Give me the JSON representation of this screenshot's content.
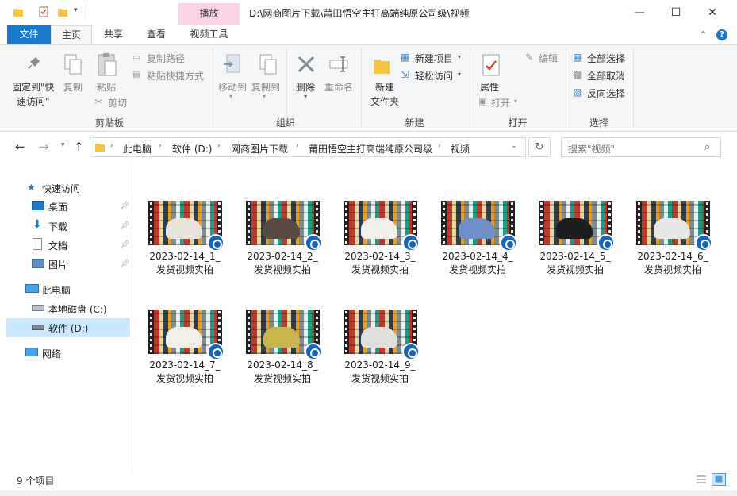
{
  "window": {
    "title": "D:\\网商图片下载\\莆田悟空主打高端纯原公司级\\视频",
    "context_tab": "播放",
    "minimize": "—",
    "maximize": "☐",
    "close": "✕"
  },
  "tabs": [
    "文件",
    "主页",
    "共享",
    "查看",
    "视频工具"
  ],
  "ribbon": {
    "clipboard": {
      "pin_quick": "固定到\"快\n速访问\"",
      "copy": "复制",
      "paste": "粘贴",
      "copy_path": "复制路径",
      "paste_shortcut": "粘贴快捷方式",
      "cut": "剪切",
      "label": "剪贴板"
    },
    "organize": {
      "move_to": "移动到",
      "copy_to": "复制到",
      "delete": "删除",
      "rename": "重命名",
      "label": "组织"
    },
    "new": {
      "new_folder": "新建\n文件夹",
      "new_item": "新建项目",
      "easy_access": "轻松访问",
      "label": "新建"
    },
    "open": {
      "properties": "属性",
      "open": "打开",
      "edit": "编辑",
      "label": "打开"
    },
    "select": {
      "select_all": "全部选择",
      "select_none": "全部取消",
      "invert": "反向选择",
      "label": "选择"
    }
  },
  "address": {
    "crumbs": [
      "此电脑",
      "软件 (D:)",
      "网商图片下载",
      "莆田悟空主打高端纯原公司级",
      "视频"
    ],
    "search_placeholder": "搜索\"视频\""
  },
  "sidebar": {
    "quick_access": "快速访问",
    "desktop": "桌面",
    "downloads": "下载",
    "documents": "文档",
    "pictures": "图片",
    "this_pc": "此电脑",
    "local_c": "本地磁盘 (C:)",
    "soft_d": "软件 (D:)",
    "network": "网络"
  },
  "files": [
    {
      "line1": "2023-02-14_1_",
      "line2": "发货视频实拍",
      "shoe": "#e8e4dc"
    },
    {
      "line1": "2023-02-14_2_",
      "line2": "发货视频实拍",
      "shoe": "#5b4a3f"
    },
    {
      "line1": "2023-02-14_3_",
      "line2": "发货视频实拍",
      "shoe": "#f1efe9"
    },
    {
      "line1": "2023-02-14_4_",
      "line2": "发货视频实拍",
      "shoe": "#6f8fc9"
    },
    {
      "line1": "2023-02-14_5_",
      "line2": "发货视频实拍",
      "shoe": "#1d1d1d"
    },
    {
      "line1": "2023-02-14_6_",
      "line2": "发货视频实拍",
      "shoe": "#e7e7e7"
    },
    {
      "line1": "2023-02-14_7_",
      "line2": "发货视频实拍",
      "shoe": "#f2f0e8"
    },
    {
      "line1": "2023-02-14_8_",
      "line2": "发货视频实拍",
      "shoe": "#c8b64a"
    },
    {
      "line1": "2023-02-14_9_",
      "line2": "发货视频实拍",
      "shoe": "#dfe0dc"
    }
  ],
  "status": {
    "count": "9 个项目"
  },
  "colors": {
    "file_tab": "#1979ca",
    "context_tab": "#fbd3e6",
    "selection": "#cce8ff",
    "video_badge": "#1565c0"
  }
}
